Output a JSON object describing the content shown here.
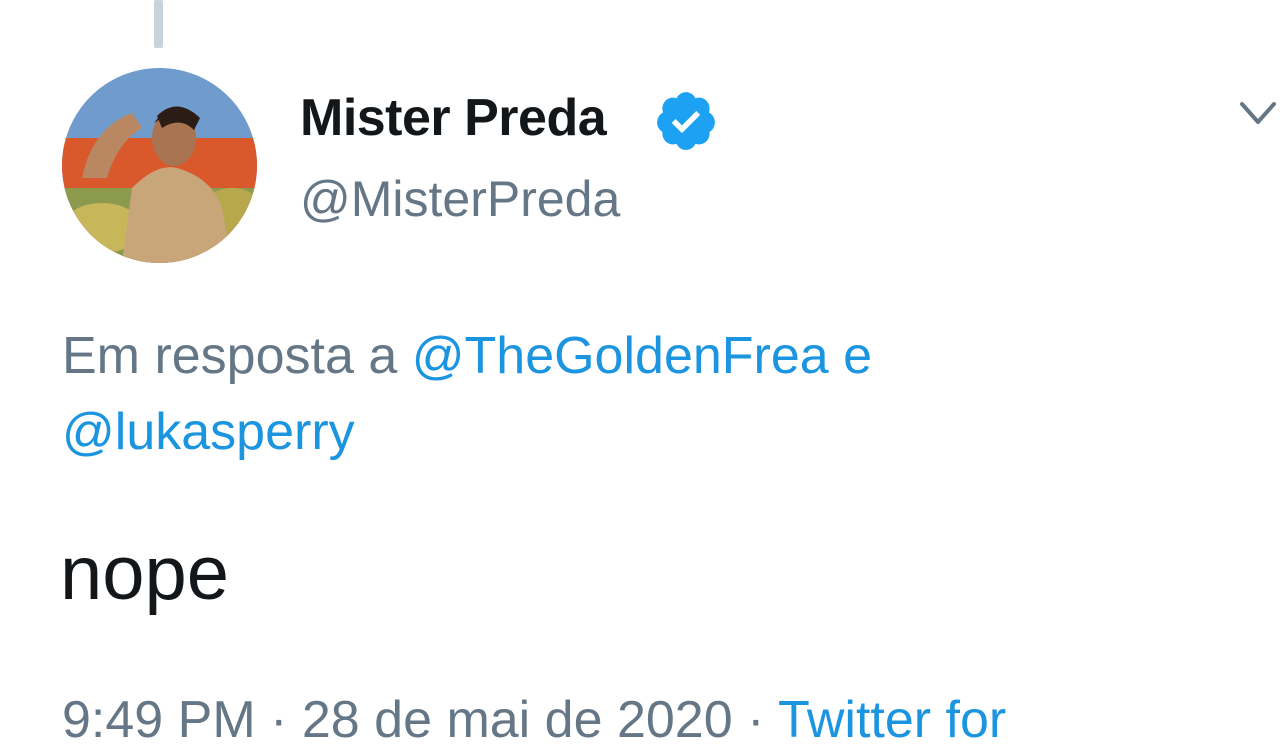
{
  "tweet": {
    "author": {
      "display_name": "Mister Preda",
      "handle": "@MisterPreda",
      "verified": true
    },
    "reply_context": {
      "prefix": "Em resposta a",
      "mention_1": "@TheGoldenFrea",
      "conjunction": "e",
      "mention_2": "@lukasperry"
    },
    "text": "nope",
    "meta": {
      "timestamp": "9:49 PM · 28 de mai de 2020",
      "separator": "·",
      "source": "Twitter for"
    }
  },
  "colors": {
    "link": "#1b95e0",
    "secondary_text": "#657786",
    "primary_text": "#14171a",
    "verified_badge": "#1da1f2",
    "thread_line": "#c9d3dc"
  },
  "icons": {
    "verified": "verified-badge-icon",
    "menu": "chevron-down-icon"
  }
}
